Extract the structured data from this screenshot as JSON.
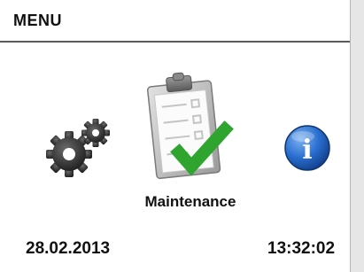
{
  "header": {
    "title": "MENU"
  },
  "menu": {
    "items": [
      {
        "id": "settings",
        "icon": "gears-icon",
        "label": ""
      },
      {
        "id": "maintenance",
        "icon": "clipboard-check-icon",
        "label": "Maintenance",
        "selected": true
      },
      {
        "id": "info",
        "icon": "info-icon",
        "label": ""
      }
    ]
  },
  "footer": {
    "date": "28.02.2013",
    "time": "13:32:02"
  },
  "colors": {
    "check": "#2fa52f",
    "info": "#1f5fc4",
    "gear": "#3a3a3a",
    "divider": "#5a5a5a"
  }
}
